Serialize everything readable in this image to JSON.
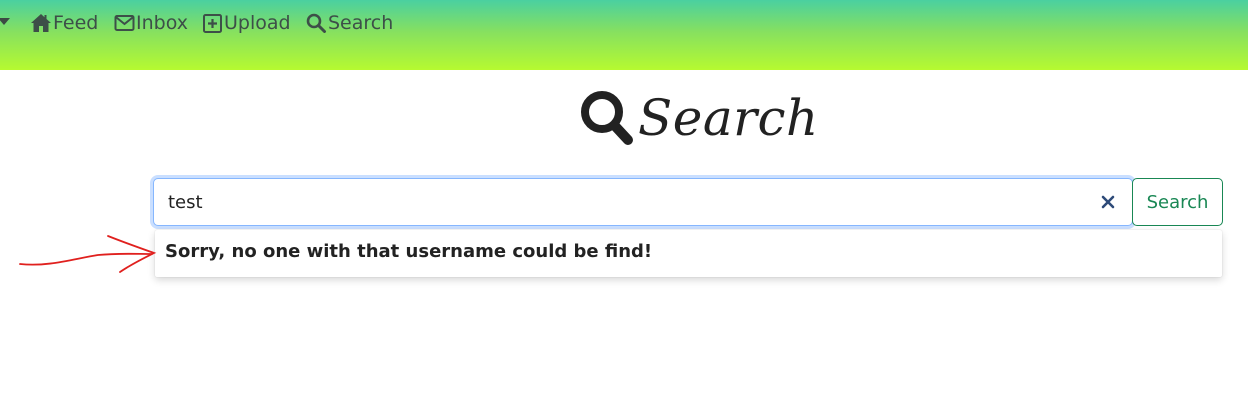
{
  "navbar": {
    "gradient_colors": [
      "#4ad0a0",
      "#b6fa30"
    ],
    "items": [
      {
        "label": "Feed",
        "icon": "home-icon"
      },
      {
        "label": "Inbox",
        "icon": "envelope-icon"
      },
      {
        "label": "Upload",
        "icon": "plus-square-icon"
      },
      {
        "label": "Search",
        "icon": "search-icon"
      }
    ],
    "menu_icon": "caret-down-icon"
  },
  "page": {
    "title": "Search",
    "title_icon": "search-icon"
  },
  "search": {
    "value": "test",
    "clear_icon": "close-icon",
    "button_label": "Search",
    "button_color": "#198754"
  },
  "results": {
    "message": "Sorry, no one with that username could be find!"
  },
  "annotation": {
    "type": "red-arrow",
    "color": "#e0201e"
  }
}
